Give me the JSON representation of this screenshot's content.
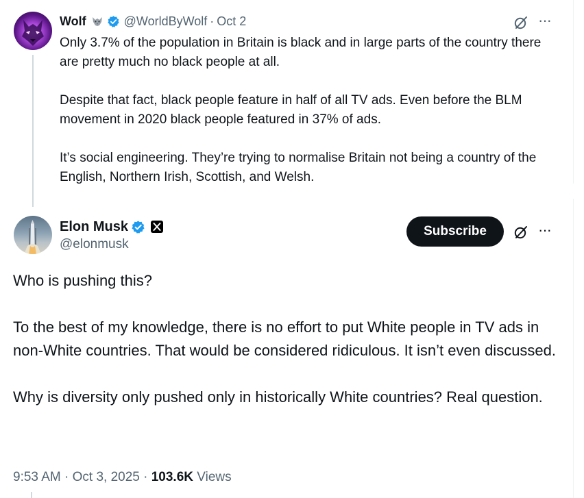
{
  "parent_tweet": {
    "display_name": "Wolf",
    "name_emoji": "wolf-emoji",
    "handle": "@WorldByWolf",
    "separator": "·",
    "date": "Oct 2",
    "paragraphs": [
      "Only 3.7% of the population in Britain is black and in large parts of the country there are pretty much no black people at all.",
      "Despite that fact, black people feature in half of all TV ads. Even before the BLM movement in 2020 black people featured in 37% of ads.",
      "It’s social engineering. They’re trying to normalise Britain not being a country of the English, Northern Irish, Scottish, and Welsh."
    ],
    "more_label": "···"
  },
  "main_tweet": {
    "display_name": "Elon Musk",
    "handle": "@elonmusk",
    "subscribe_label": "Subscribe",
    "more_label": "···",
    "paragraphs": [
      "Who is pushing this?",
      "To the best of my knowledge, there is no effort to put White people in TV ads in non-White countries. That would be considered ridiculous. It isn’t even discussed.",
      "Why is diversity only pushed only in historically White countries? Real question."
    ],
    "time": "9:53 AM",
    "date": "Oct 3, 2025",
    "separator": "·",
    "views_count": "103.6K",
    "views_label": "Views"
  },
  "colors": {
    "text_primary": "#0f1419",
    "text_secondary": "#536471",
    "verified_blue": "#1d9bf0",
    "thread_line": "#cfd9de",
    "subscribe_bg": "#0f1419"
  },
  "icons": [
    "verified-badge-icon",
    "grok-icon",
    "more-icon",
    "x-logo-icon"
  ]
}
